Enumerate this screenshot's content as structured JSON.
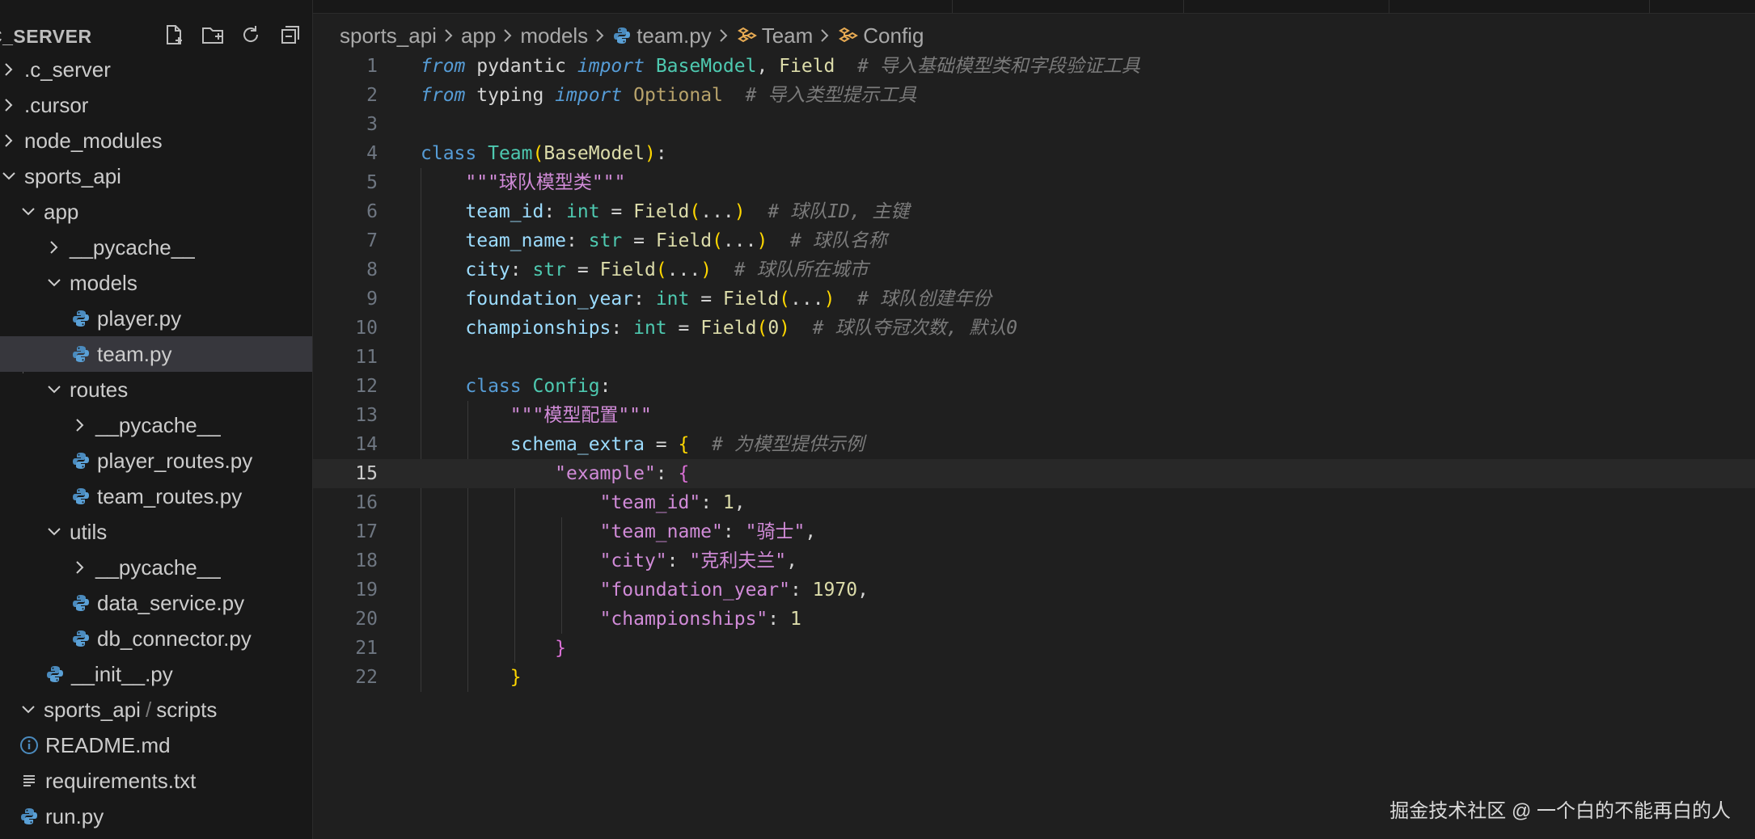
{
  "explorer": {
    "title": "C_SERVER",
    "tree": [
      {
        "label": ".c_server",
        "kind": "folder",
        "state": "collapsed",
        "depth": 0
      },
      {
        "label": ".cursor",
        "kind": "folder",
        "state": "collapsed",
        "depth": 0
      },
      {
        "label": "node_modules",
        "kind": "folder",
        "state": "collapsed",
        "depth": 0
      },
      {
        "label": "sports_api",
        "kind": "folder",
        "state": "expanded",
        "depth": 0
      },
      {
        "label": "app",
        "kind": "folder",
        "state": "expanded",
        "depth": 1
      },
      {
        "label": "__pycache__",
        "kind": "folder",
        "state": "collapsed",
        "depth": 2
      },
      {
        "label": "models",
        "kind": "folder",
        "state": "expanded",
        "depth": 2
      },
      {
        "label": "player.py",
        "kind": "python",
        "depth": 3
      },
      {
        "label": "team.py",
        "kind": "python",
        "depth": 3,
        "selected": true
      },
      {
        "label": "routes",
        "kind": "folder",
        "state": "expanded",
        "depth": 2
      },
      {
        "label": "__pycache__",
        "kind": "folder",
        "state": "collapsed",
        "depth": 3
      },
      {
        "label": "player_routes.py",
        "kind": "python",
        "depth": 3
      },
      {
        "label": "team_routes.py",
        "kind": "python",
        "depth": 3
      },
      {
        "label": "utils",
        "kind": "folder",
        "state": "expanded",
        "depth": 2
      },
      {
        "label": "__pycache__",
        "kind": "folder",
        "state": "collapsed",
        "depth": 3
      },
      {
        "label": "data_service.py",
        "kind": "python",
        "depth": 3
      },
      {
        "label": "db_connector.py",
        "kind": "python",
        "depth": 3
      },
      {
        "label": "__init__.py",
        "kind": "python",
        "depth": 2
      },
      {
        "label": "sports_api",
        "label_suffix": "scripts",
        "kind": "folder",
        "state": "expanded",
        "depth": 1
      },
      {
        "label": "README.md",
        "kind": "info",
        "depth": 1
      },
      {
        "label": "requirements.txt",
        "kind": "text",
        "depth": 1
      },
      {
        "label": "run.py",
        "kind": "python",
        "depth": 1
      }
    ]
  },
  "breadcrumb": {
    "parts": [
      "sports_api",
      "app",
      "models",
      "team.py",
      "Team",
      "Config"
    ]
  },
  "editor": {
    "current_line": 15,
    "lines": [
      {
        "n": "1",
        "tokens": [
          [
            "kw-i",
            "from"
          ],
          [
            "mod",
            " pydantic "
          ],
          [
            "kw-i",
            "import"
          ],
          [
            "mod",
            " "
          ],
          [
            "cls",
            "BaseModel"
          ],
          [
            "mod",
            ", "
          ],
          [
            "fn",
            "Field"
          ],
          [
            "mod",
            "  "
          ],
          [
            "cmt",
            "# 导入基础模型类和字段验证工具"
          ]
        ]
      },
      {
        "n": "2",
        "tokens": [
          [
            "kw-i",
            "from"
          ],
          [
            "mod",
            " typing "
          ],
          [
            "kw-i",
            "import"
          ],
          [
            "mod",
            " "
          ],
          [
            "opt",
            "Optional"
          ],
          [
            "mod",
            "  "
          ],
          [
            "cmt",
            "# 导入类型提示工具"
          ]
        ]
      },
      {
        "n": "3",
        "tokens": []
      },
      {
        "n": "4",
        "tokens": [
          [
            "kw",
            "class"
          ],
          [
            "mod",
            " "
          ],
          [
            "cls",
            "Team"
          ],
          [
            "br1",
            "("
          ],
          [
            "fn",
            "BaseModel"
          ],
          [
            "br1",
            ")"
          ],
          [
            "mod",
            ":"
          ]
        ]
      },
      {
        "n": "5",
        "tokens": [
          [
            "mod",
            "    "
          ],
          [
            "doc",
            "\"\"\"球队模型类\"\"\""
          ]
        ]
      },
      {
        "n": "6",
        "tokens": [
          [
            "mod",
            "    "
          ],
          [
            "var",
            "team_id"
          ],
          [
            "mod",
            ": "
          ],
          [
            "typ",
            "int"
          ],
          [
            "mod",
            " = "
          ],
          [
            "fn",
            "Field"
          ],
          [
            "br1",
            "("
          ],
          [
            "mod",
            "..."
          ],
          [
            "br1",
            ")"
          ],
          [
            "mod",
            "  "
          ],
          [
            "cmt",
            "# 球队ID, 主键"
          ]
        ]
      },
      {
        "n": "7",
        "tokens": [
          [
            "mod",
            "    "
          ],
          [
            "var",
            "team_name"
          ],
          [
            "mod",
            ": "
          ],
          [
            "typ",
            "str"
          ],
          [
            "mod",
            " = "
          ],
          [
            "fn",
            "Field"
          ],
          [
            "br1",
            "("
          ],
          [
            "mod",
            "..."
          ],
          [
            "br1",
            ")"
          ],
          [
            "mod",
            "  "
          ],
          [
            "cmt",
            "# 球队名称"
          ]
        ]
      },
      {
        "n": "8",
        "tokens": [
          [
            "mod",
            "    "
          ],
          [
            "var",
            "city"
          ],
          [
            "mod",
            ": "
          ],
          [
            "typ",
            "str"
          ],
          [
            "mod",
            " = "
          ],
          [
            "fn",
            "Field"
          ],
          [
            "br1",
            "("
          ],
          [
            "mod",
            "..."
          ],
          [
            "br1",
            ")"
          ],
          [
            "mod",
            "  "
          ],
          [
            "cmt",
            "# 球队所在城市"
          ]
        ]
      },
      {
        "n": "9",
        "tokens": [
          [
            "mod",
            "    "
          ],
          [
            "var",
            "foundation_year"
          ],
          [
            "mod",
            ": "
          ],
          [
            "typ",
            "int"
          ],
          [
            "mod",
            " = "
          ],
          [
            "fn",
            "Field"
          ],
          [
            "br1",
            "("
          ],
          [
            "mod",
            "..."
          ],
          [
            "br1",
            ")"
          ],
          [
            "mod",
            "  "
          ],
          [
            "cmt",
            "# 球队创建年份"
          ]
        ]
      },
      {
        "n": "10",
        "tokens": [
          [
            "mod",
            "    "
          ],
          [
            "var",
            "championships"
          ],
          [
            "mod",
            ": "
          ],
          [
            "typ",
            "int"
          ],
          [
            "mod",
            " = "
          ],
          [
            "fn",
            "Field"
          ],
          [
            "br1",
            "("
          ],
          [
            "num",
            "0"
          ],
          [
            "br1",
            ")"
          ],
          [
            "mod",
            "  "
          ],
          [
            "cmt",
            "# 球队夺冠次数, 默认0"
          ]
        ]
      },
      {
        "n": "11",
        "tokens": []
      },
      {
        "n": "12",
        "tokens": [
          [
            "mod",
            "    "
          ],
          [
            "kw",
            "class"
          ],
          [
            "mod",
            " "
          ],
          [
            "cls",
            "Config"
          ],
          [
            "mod",
            ":"
          ]
        ]
      },
      {
        "n": "13",
        "tokens": [
          [
            "mod",
            "        "
          ],
          [
            "doc",
            "\"\"\"模型配置\"\"\""
          ]
        ]
      },
      {
        "n": "14",
        "tokens": [
          [
            "mod",
            "        "
          ],
          [
            "var",
            "schema_extra"
          ],
          [
            "mod",
            " = "
          ],
          [
            "br1",
            "{"
          ],
          [
            "mod",
            "  "
          ],
          [
            "cmt",
            "# 为模型提供示例"
          ]
        ]
      },
      {
        "n": "15",
        "tokens": [
          [
            "mod",
            "            "
          ],
          [
            "key",
            "\"example\""
          ],
          [
            "mod",
            ": "
          ],
          [
            "br2",
            "{"
          ]
        ]
      },
      {
        "n": "16",
        "tokens": [
          [
            "mod",
            "                "
          ],
          [
            "key",
            "\"team_id\""
          ],
          [
            "mod",
            ": "
          ],
          [
            "num",
            "1"
          ],
          [
            "mod",
            ","
          ]
        ]
      },
      {
        "n": "17",
        "tokens": [
          [
            "mod",
            "                "
          ],
          [
            "key",
            "\"team_name\""
          ],
          [
            "mod",
            ": "
          ],
          [
            "val-s",
            "\"骑士\""
          ],
          [
            "mod",
            ","
          ]
        ]
      },
      {
        "n": "18",
        "tokens": [
          [
            "mod",
            "                "
          ],
          [
            "key",
            "\"city\""
          ],
          [
            "mod",
            ": "
          ],
          [
            "val-s",
            "\"克利夫兰\""
          ],
          [
            "mod",
            ","
          ]
        ]
      },
      {
        "n": "19",
        "tokens": [
          [
            "mod",
            "                "
          ],
          [
            "key",
            "\"foundation_year\""
          ],
          [
            "mod",
            ": "
          ],
          [
            "num",
            "1970"
          ],
          [
            "mod",
            ","
          ]
        ]
      },
      {
        "n": "20",
        "tokens": [
          [
            "mod",
            "                "
          ],
          [
            "key",
            "\"championships\""
          ],
          [
            "mod",
            ": "
          ],
          [
            "num",
            "1"
          ]
        ]
      },
      {
        "n": "21",
        "tokens": [
          [
            "mod",
            "            "
          ],
          [
            "br2",
            "}"
          ]
        ]
      },
      {
        "n": "22",
        "tokens": [
          [
            "mod",
            "        "
          ],
          [
            "br1",
            "}"
          ]
        ]
      }
    ]
  },
  "watermark": "掘金技术社区 @ 一个白的不能再白的人"
}
